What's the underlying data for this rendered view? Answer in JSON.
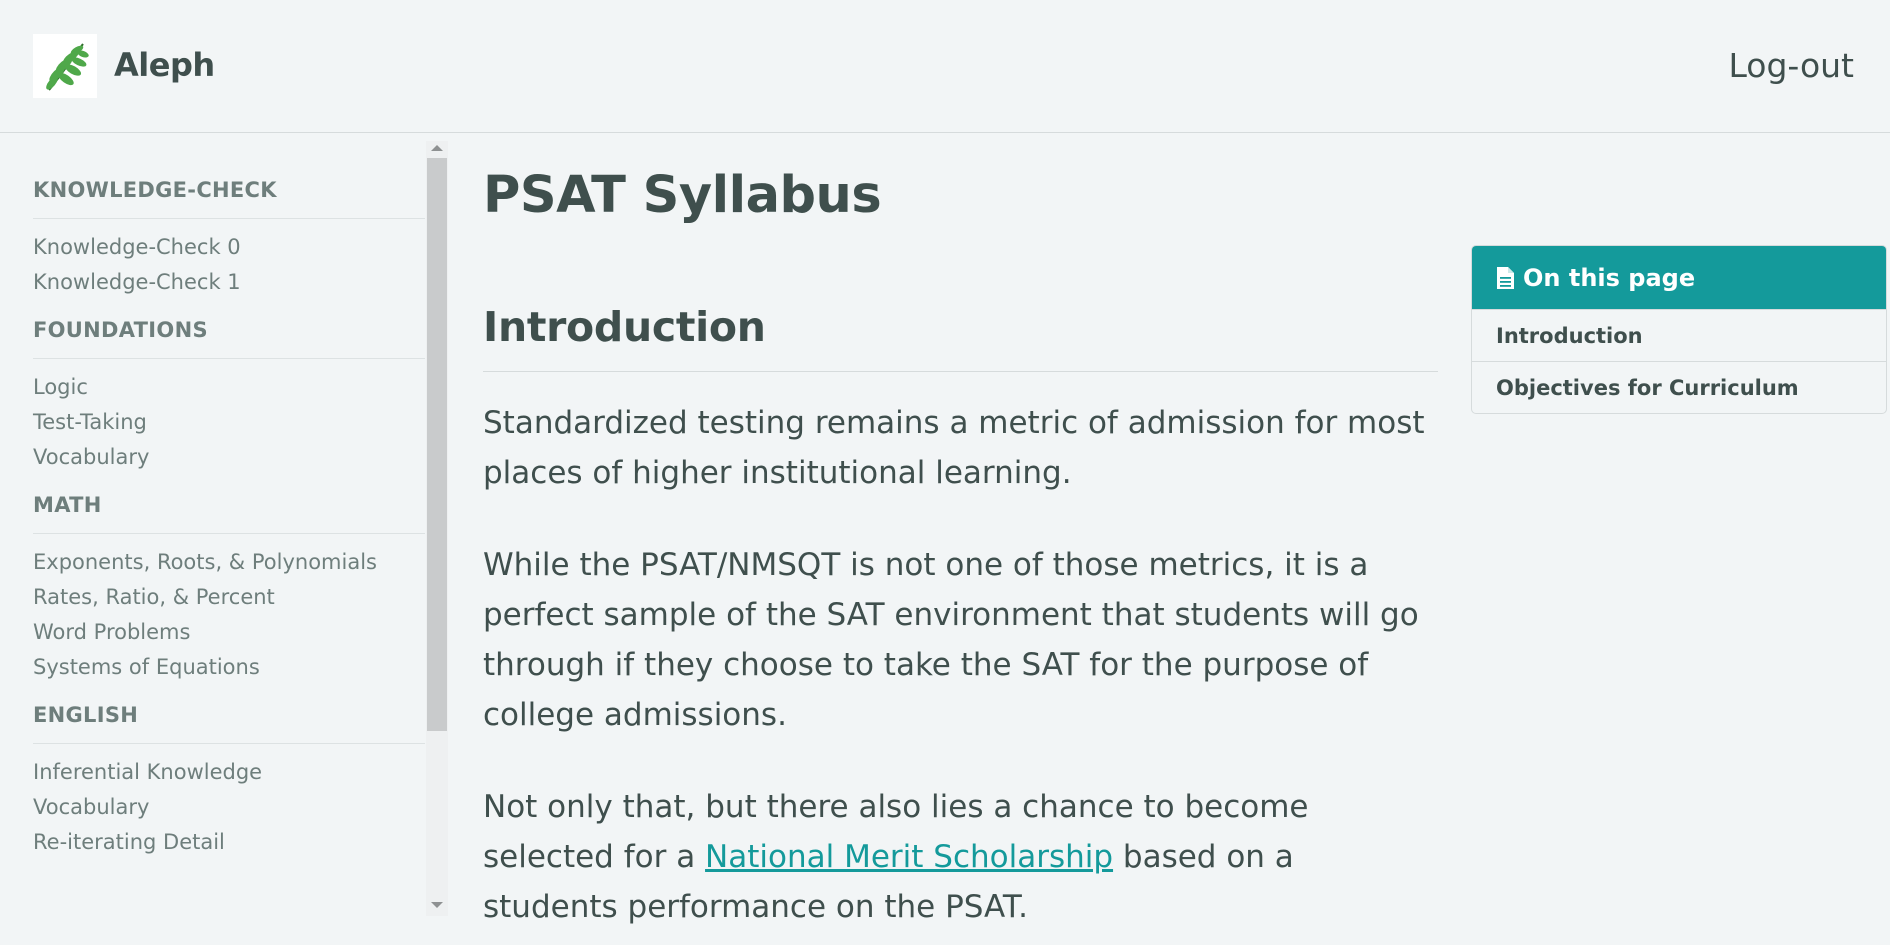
{
  "header": {
    "brand": "Aleph",
    "logout_label": "Log-out"
  },
  "sidebar": {
    "sections": [
      {
        "title": "KNOWLEDGE-CHECK",
        "items": [
          "Knowledge-Check 0",
          "Knowledge-Check 1"
        ]
      },
      {
        "title": "FOUNDATIONS",
        "items": [
          "Logic",
          "Test-Taking",
          "Vocabulary"
        ]
      },
      {
        "title": "MATH",
        "items": [
          "Exponents, Roots, & Polynomials",
          "Rates, Ratio, & Percent",
          "Word Problems",
          "Systems of Equations"
        ]
      },
      {
        "title": "ENGLISH",
        "items": [
          "Inferential Knowledge",
          "Vocabulary",
          "Re-iterating Detail"
        ]
      }
    ]
  },
  "main": {
    "title": "PSAT Syllabus",
    "intro_heading": "Introduction",
    "para1": "Standardized testing remains a metric of admission for most places of higher institutional learning.",
    "para2": "While the PSAT/NMSQT is not one of those metrics, it is a perfect sample of the SAT environment that students will go through if they choose to take the SAT for the purpose of college admissions.",
    "para3_before": "Not only that, but there also lies a chance to become selected for a ",
    "para3_link": "National Merit Scholarship",
    "para3_after": " based on a students performance on the PSAT."
  },
  "toc": {
    "title": "On this page",
    "items": [
      "Introduction",
      "Objectives for Curriculum"
    ]
  },
  "icons": {
    "logo": "fern-logo-icon",
    "toc": "document-icon"
  },
  "colors": {
    "accent": "#149a9b",
    "background": "#f2f5f6",
    "text": "#3f4f4d",
    "muted": "#6e7e7c"
  }
}
